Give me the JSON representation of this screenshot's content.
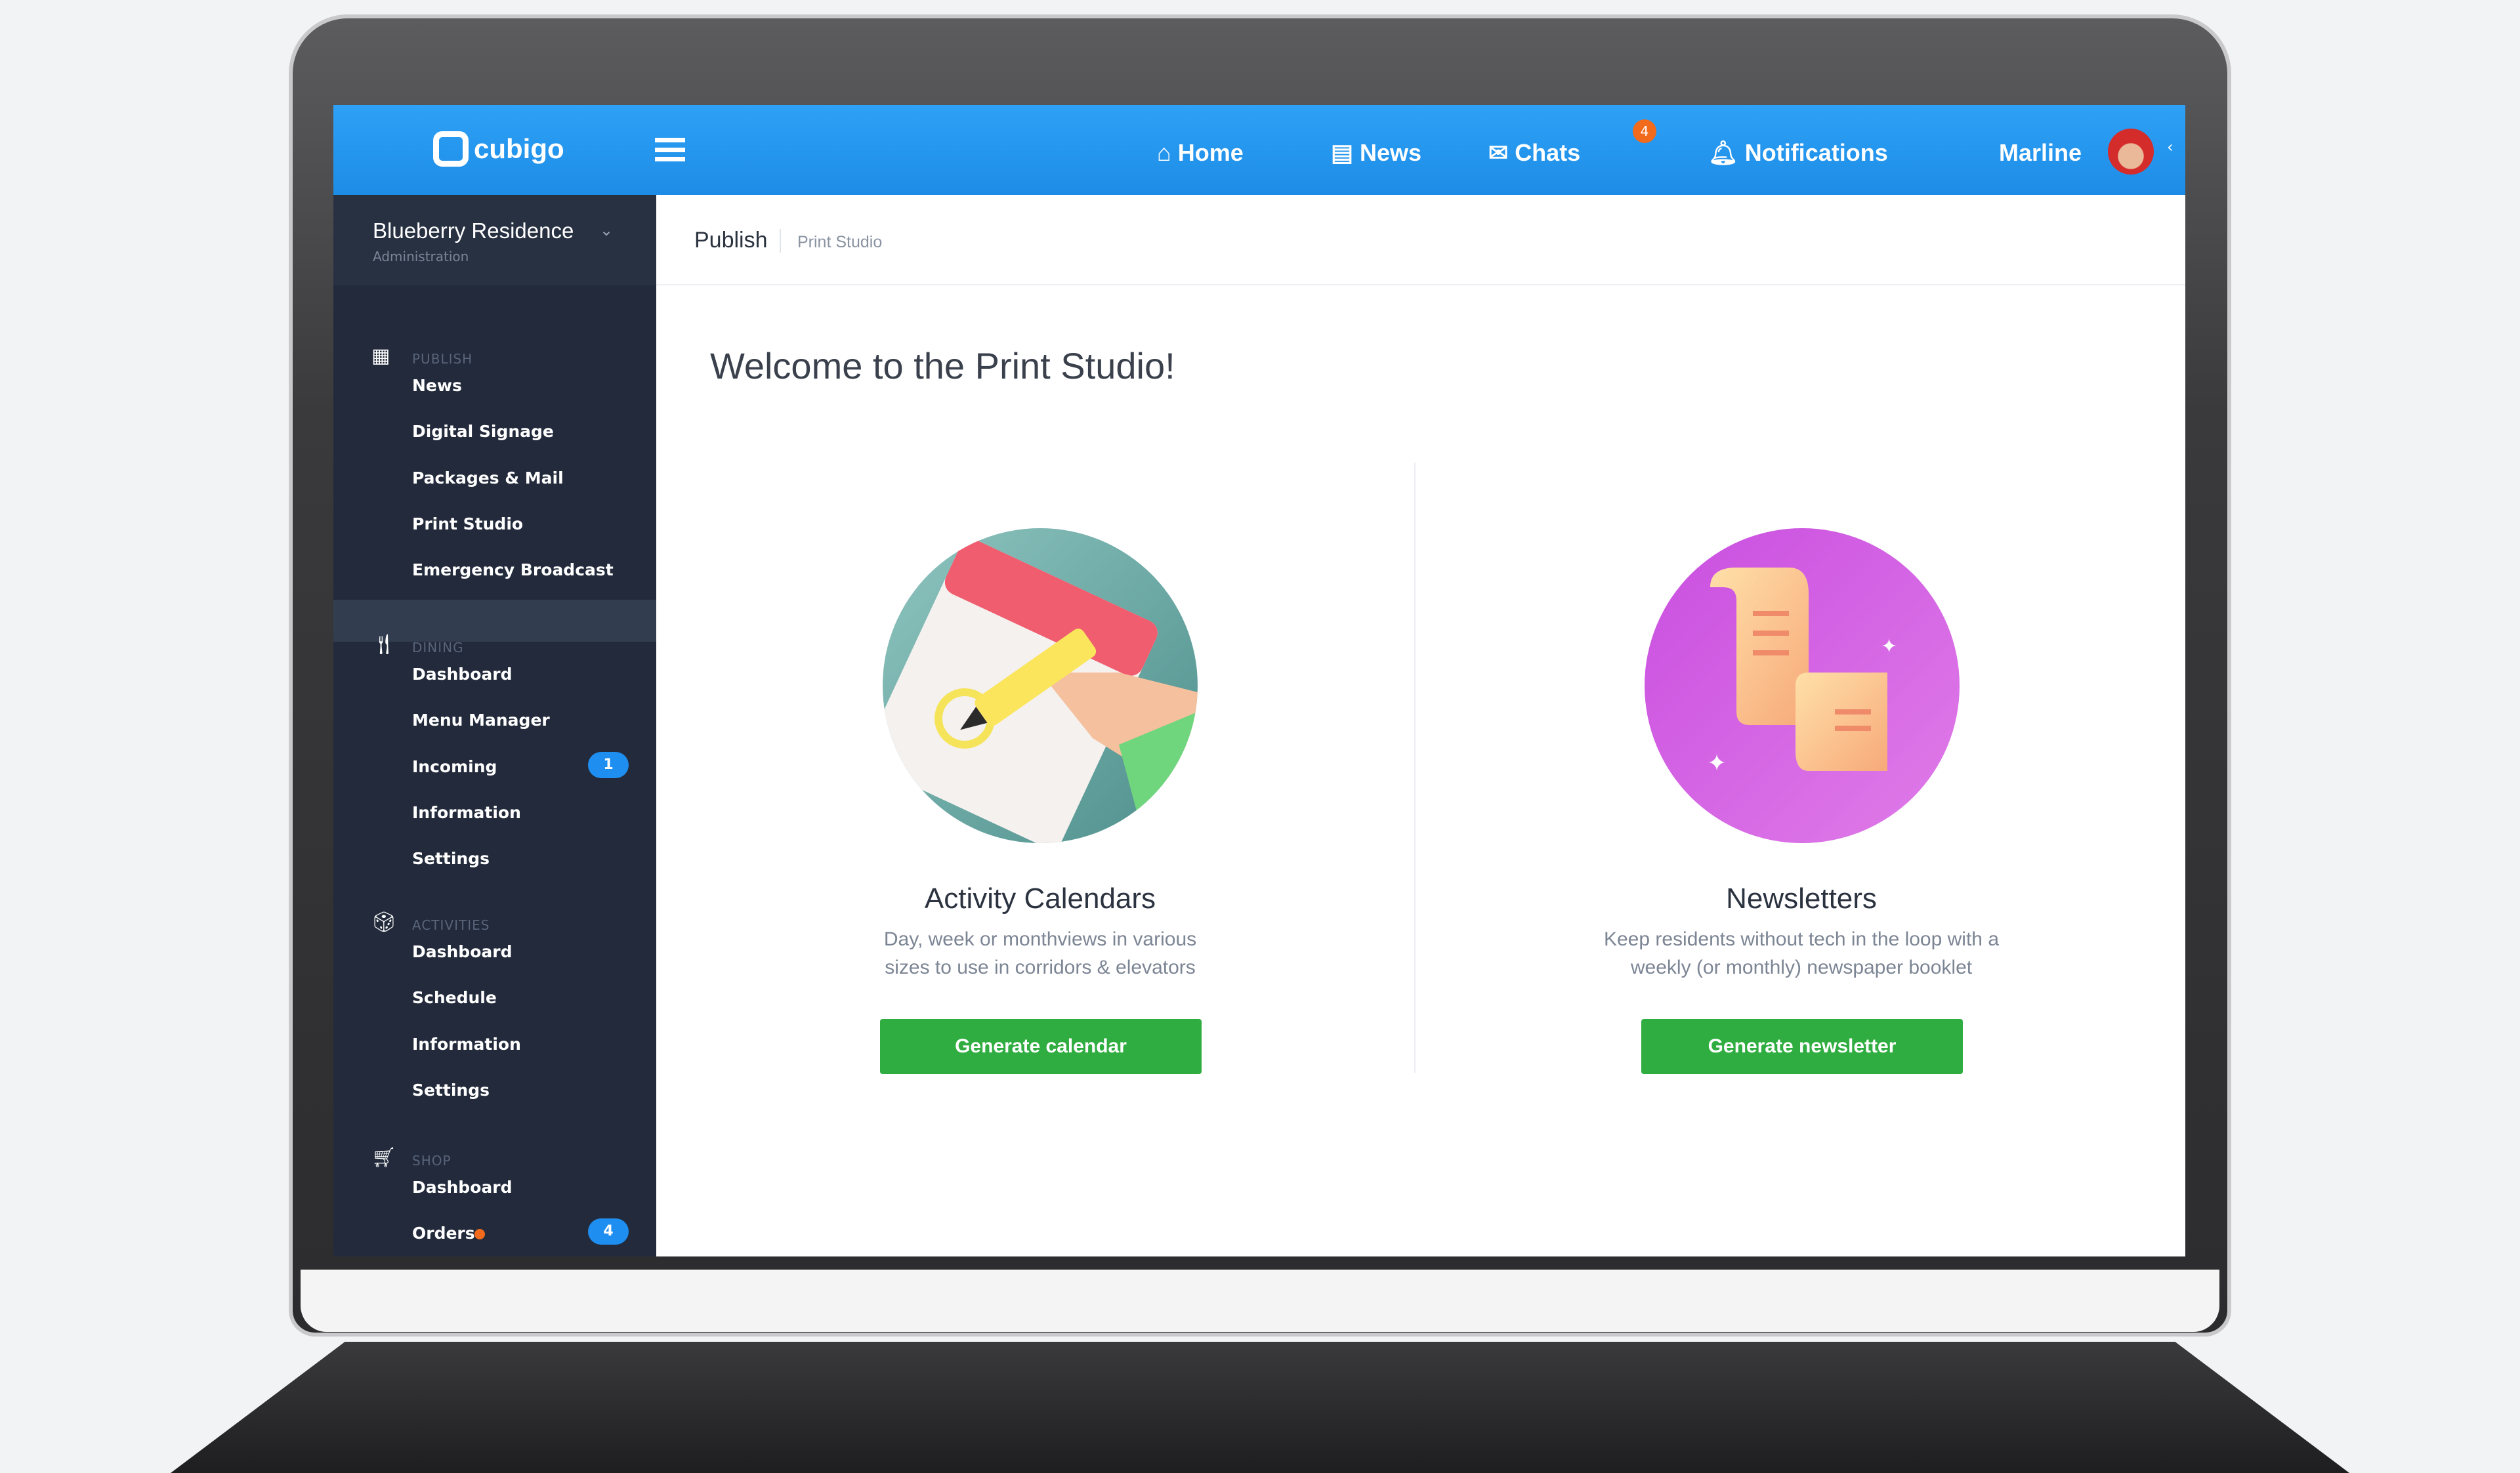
{
  "topbar": {
    "logo": "cubigo",
    "nav": [
      {
        "label": "Home",
        "icon": "home-icon"
      },
      {
        "label": "News",
        "icon": "newspaper-icon"
      },
      {
        "label": "Chats",
        "icon": "envelope-icon",
        "badge": "4"
      },
      {
        "label": "Notifications",
        "icon": "bell-icon"
      }
    ],
    "user": "Marline"
  },
  "sidebar": {
    "residence": "Blueberry Residence",
    "role": "Administration",
    "sections": [
      {
        "title": "PUBLISH",
        "items": [
          "News",
          "Digital Signage",
          "Packages & Mail",
          "Print Studio",
          "Emergency Broadcast"
        ]
      },
      {
        "title": "DINING",
        "items": [
          "Dashboard",
          "Menu Manager",
          "Incoming",
          "Information",
          "Settings"
        ]
      },
      {
        "title": "ACTIVITIES",
        "items": [
          "Dashboard",
          "Schedule",
          "Information",
          "Settings"
        ]
      },
      {
        "title": "SHOP",
        "items": [
          "Dashboard",
          "Orders"
        ]
      }
    ],
    "active": "Print Studio",
    "incoming_badge": "1",
    "orders_badge": "4"
  },
  "breadcrumb": {
    "parent": "Publish",
    "current": "Print Studio"
  },
  "main": {
    "title": "Welcome to the Print Studio!",
    "cards": [
      {
        "title": "Activity Calendars",
        "desc1": "Day, week or monthviews in various",
        "desc2": "sizes to use in corridors & elevators",
        "button": "Generate calendar"
      },
      {
        "title": "Newsletters",
        "desc1": "Keep residents without tech in the loop with a",
        "desc2": "weekly (or monthly) newspaper booklet",
        "button": "Generate newsletter"
      }
    ]
  },
  "colors": {
    "accent": "#1e8ee8",
    "sidebar": "#222a3b",
    "button": "#2fad40",
    "badge": "#1e8ef0",
    "alert": "#f26b1d"
  }
}
